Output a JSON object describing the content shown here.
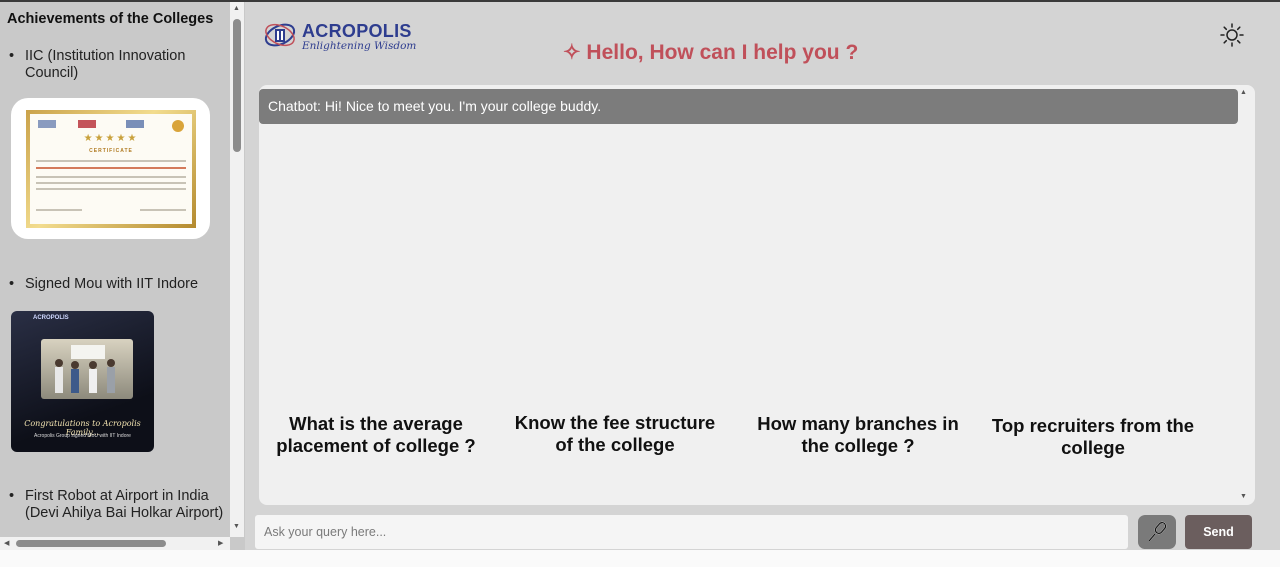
{
  "sidebar": {
    "title": "Achievements of the Colleges",
    "items": [
      {
        "label": "IIC (Institution Innovation Council)"
      },
      {
        "label": "Signed Mou with IIT Indore"
      },
      {
        "label": "First Robot at Airport in India (Devi Ahilya Bai Holkar Airport)"
      }
    ],
    "cert": {
      "title": "CERTIFICATE",
      "stars": "★★★★★"
    },
    "mou": {
      "brand": "ACROPOLIS",
      "script": "Congratulations to Acropolis Family...",
      "caption": "Acropolis Group signed MoU with IIT Indore"
    }
  },
  "header": {
    "logo_name": "ACROPOLIS",
    "logo_tagline": "Enlightening Wisdom",
    "greeting": "✧ Hello, How can I help you ?",
    "theme_icon": "sun-icon"
  },
  "chat": {
    "messages": [
      {
        "text": "Chatbot: Hi! Nice to meet you. I'm your college buddy."
      }
    ],
    "suggestions": [
      "What is the average placement of college ?",
      "Know the fee structure of the college",
      "How many branches in the college ?",
      "Top recruiters from the college"
    ]
  },
  "composer": {
    "placeholder": "Ask your query here...",
    "mic_icon": "microphone-icon",
    "send_label": "Send"
  },
  "colors": {
    "greeting": "#c0505a",
    "brand": "#2e3d8f",
    "send": "#6b5e5e",
    "bot_bubble": "#7c7c7c"
  }
}
